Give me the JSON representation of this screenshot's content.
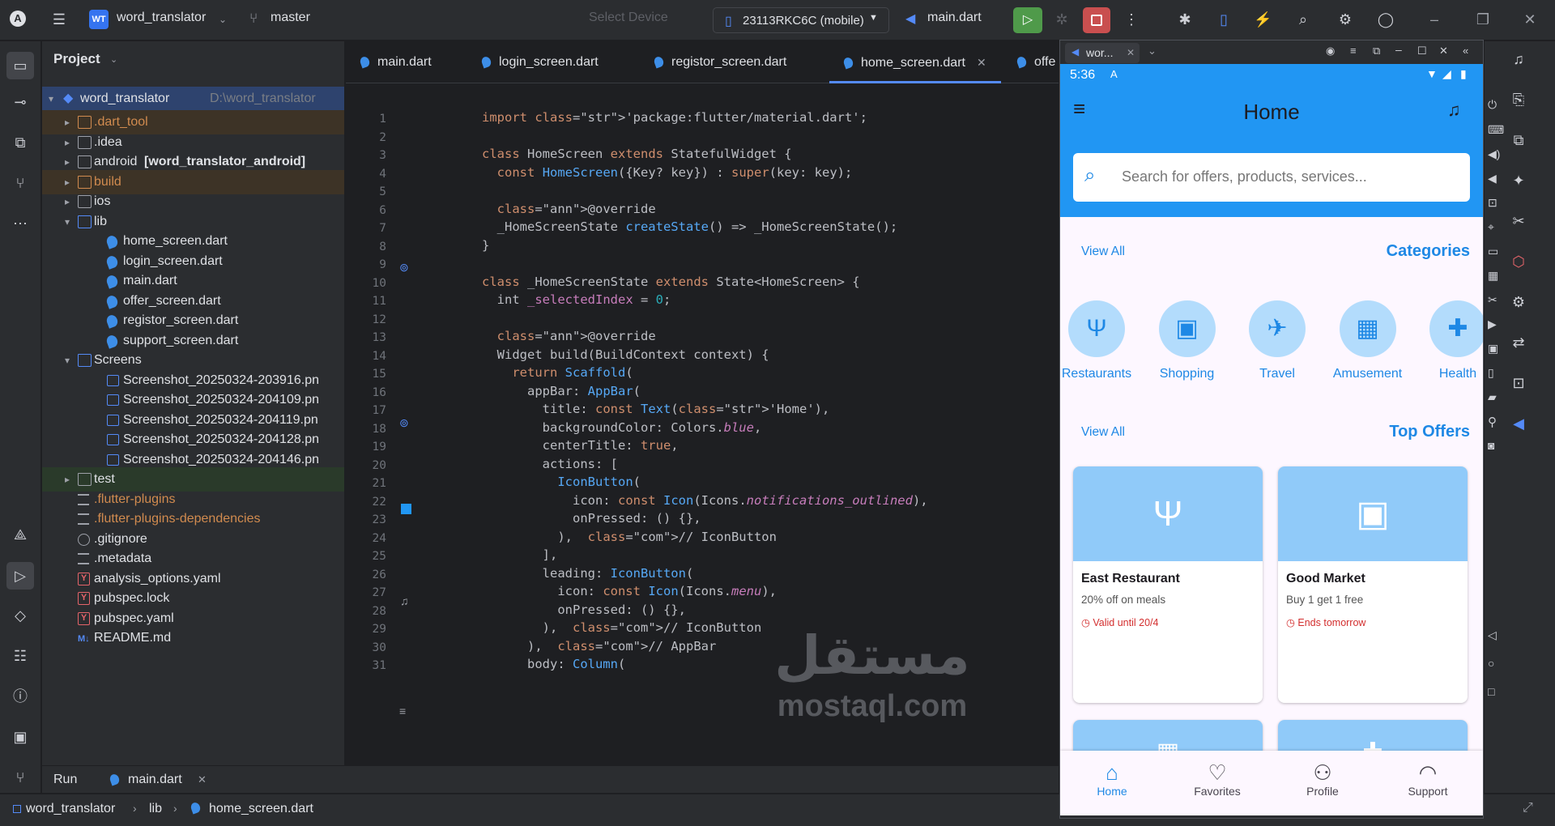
{
  "titlebar": {
    "project_badge": "WT",
    "project_name": "word_translator",
    "branch": "master",
    "device_placeholder": "Select Device",
    "device": "23113RKC6C (mobile)",
    "run_config": "main.dart"
  },
  "project_panel": {
    "title": "Project",
    "root": {
      "name": "word_translator",
      "path": "D:\\word_translator"
    },
    "items": [
      {
        "label": ".dart_tool",
        "extra": ""
      },
      {
        "label": ".idea",
        "extra": ""
      },
      {
        "label": "android",
        "extra": "[word_translator_android]"
      },
      {
        "label": "build",
        "extra": ""
      },
      {
        "label": "ios",
        "extra": ""
      },
      {
        "label": "lib",
        "extra": ""
      },
      {
        "label": "home_screen.dart",
        "extra": ""
      },
      {
        "label": "login_screen.dart",
        "extra": ""
      },
      {
        "label": "main.dart",
        "extra": ""
      },
      {
        "label": "offer_screen.dart",
        "extra": ""
      },
      {
        "label": "registor_screen.dart",
        "extra": ""
      },
      {
        "label": "support_screen.dart",
        "extra": ""
      },
      {
        "label": "Screens",
        "extra": ""
      },
      {
        "label": "Screenshot_20250324-203916.pn",
        "extra": ""
      },
      {
        "label": "Screenshot_20250324-204109.pn",
        "extra": ""
      },
      {
        "label": "Screenshot_20250324-204119.pn",
        "extra": ""
      },
      {
        "label": "Screenshot_20250324-204128.pn",
        "extra": ""
      },
      {
        "label": "Screenshot_20250324-204146.pn",
        "extra": ""
      },
      {
        "label": "test",
        "extra": ""
      },
      {
        "label": ".flutter-plugins",
        "extra": ""
      },
      {
        "label": ".flutter-plugins-dependencies",
        "extra": ""
      },
      {
        "label": ".gitignore",
        "extra": ""
      },
      {
        "label": ".metadata",
        "extra": ""
      },
      {
        "label": "analysis_options.yaml",
        "extra": ""
      },
      {
        "label": "pubspec.lock",
        "extra": ""
      },
      {
        "label": "pubspec.yaml",
        "extra": ""
      },
      {
        "label": "README.md",
        "extra": ""
      }
    ]
  },
  "editor_tabs": [
    "main.dart",
    "login_screen.dart",
    "registor_screen.dart",
    "home_screen.dart",
    "offe"
  ],
  "code_lines": [
    "import 'package:flutter/material.dart';",
    "",
    "class HomeScreen extends StatefulWidget {",
    "  const HomeScreen({Key? key}) : super(key: key);",
    "",
    "  @override",
    "  _HomeScreenState createState() => _HomeScreenState();",
    "}",
    "",
    "class _HomeScreenState extends State<HomeScreen> {",
    "  int _selectedIndex = 0;",
    "",
    "  @override",
    "  Widget build(BuildContext context) {",
    "    return Scaffold(",
    "      appBar: AppBar(",
    "        title: const Text('Home'),",
    "        backgroundColor: Colors.blue,",
    "        centerTitle: true,",
    "        actions: [",
    "          IconButton(",
    "            icon: const Icon(Icons.notifications_outlined),",
    "            onPressed: () {},",
    "          ),  // IconButton",
    "        ],",
    "        leading: IconButton(",
    "          icon: const Icon(Icons.menu),",
    "          onPressed: () {},",
    "        ),  // IconButton",
    "      ),  // AppBar",
    "      body: Column("
  ],
  "run_bar": {
    "label": "Run",
    "config": "main.dart"
  },
  "status_bar": {
    "crumbs": [
      "word_translator",
      "lib",
      "home_screen.dart"
    ]
  },
  "emulator": {
    "tab_title": "wor..."
  },
  "phone": {
    "time": "5:36",
    "app_title": "Home",
    "search_placeholder": "Search for offers, products, services...",
    "view_all_1": "View All",
    "categories_title": "Categories",
    "categories": [
      {
        "label": "Restaurants",
        "icon": "restaurant-icon"
      },
      {
        "label": "Shopping",
        "icon": "shopping-bag-icon"
      },
      {
        "label": "Travel",
        "icon": "airplane-icon"
      },
      {
        "label": "Amusement",
        "icon": "movie-icon"
      },
      {
        "label": "Health",
        "icon": "healing-icon"
      }
    ],
    "view_all_2": "View All",
    "offers_title": "Top Offers",
    "offers": [
      {
        "name": "East Restaurant",
        "desc": "20% off on meals",
        "validity": "Valid until 20/4"
      },
      {
        "name": "Good Market",
        "desc": "Buy 1 get 1 free",
        "validity": "Ends tomorrow"
      }
    ],
    "nav": [
      "Home",
      "Favorites",
      "Profile",
      "Support"
    ]
  },
  "watermark": {
    "arabic": "مستقل",
    "latin": "mostaql.com"
  },
  "colors": {
    "accent": "#2196f3",
    "ide_bg": "#1e1f22",
    "panel_bg": "#2b2d30",
    "phone_accent": "#1e88e5"
  }
}
